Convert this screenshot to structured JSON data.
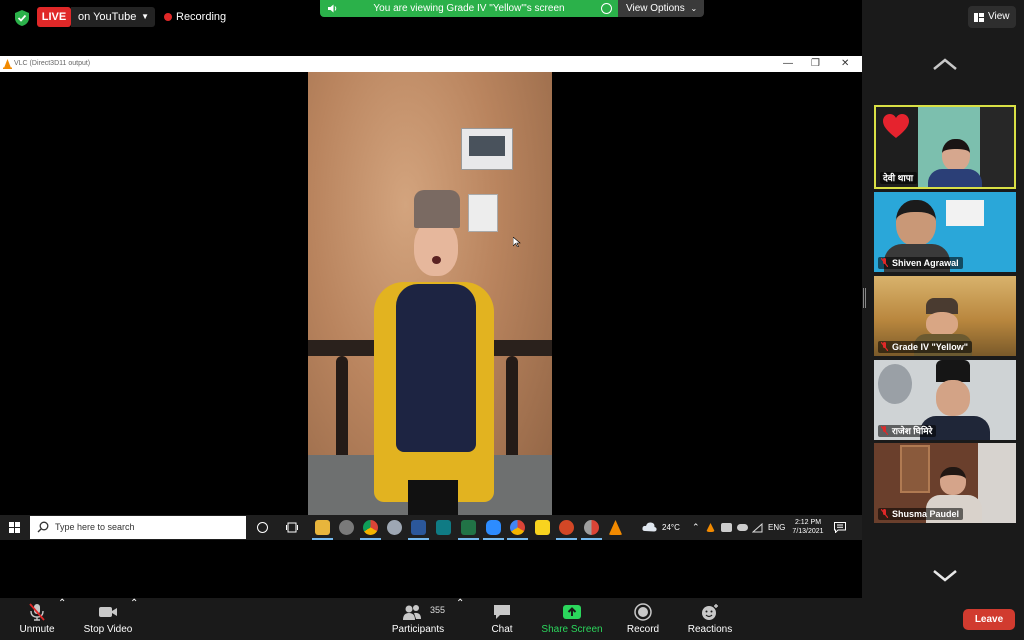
{
  "topbar": {
    "live_label": "LIVE",
    "live_target": "on YouTube",
    "recording_label": "Recording"
  },
  "share_banner": {
    "text": "You are viewing Grade IV \"Yellow\"'s screen",
    "view_options": "View Options"
  },
  "vlc": {
    "title": "VLC (Direct3D11 output)",
    "minimize": "—",
    "restore": "❐",
    "close": "✕"
  },
  "taskbar": {
    "search_placeholder": "Type here to search",
    "weather": "24°C",
    "language": "ENG",
    "time": "2:12 PM",
    "date": "7/13/2021",
    "apps": [
      "file-explorer",
      "edge-legacy",
      "chrome",
      "mail",
      "word",
      "outlook",
      "excel",
      "zoom",
      "chrome-canary",
      "sticky-notes",
      "powerpoint",
      "chrome-dev",
      "vlc"
    ]
  },
  "right_panel": {
    "view_label": "View",
    "participants": [
      {
        "name": "देवी थापा",
        "active": true,
        "muted": false
      },
      {
        "name": "Shiven Agrawal",
        "active": false,
        "muted": true
      },
      {
        "name": "Grade IV \"Yellow\"",
        "active": false,
        "muted": true
      },
      {
        "name": "राजेश घिमिरे",
        "active": false,
        "muted": true
      },
      {
        "name": "Shusma Paudel",
        "active": false,
        "muted": true
      }
    ]
  },
  "toolbar": {
    "unmute": "Unmute",
    "stop_video": "Stop Video",
    "participants": "Participants",
    "participant_count": "355",
    "chat": "Chat",
    "share_screen": "Share Screen",
    "record": "Record",
    "reactions": "Reactions",
    "leave": "Leave"
  },
  "colors": {
    "accent_green": "#2bb14a",
    "live_red": "#e02828",
    "leave_red": "#d13b2f",
    "active_speaker": "#d9e045"
  }
}
